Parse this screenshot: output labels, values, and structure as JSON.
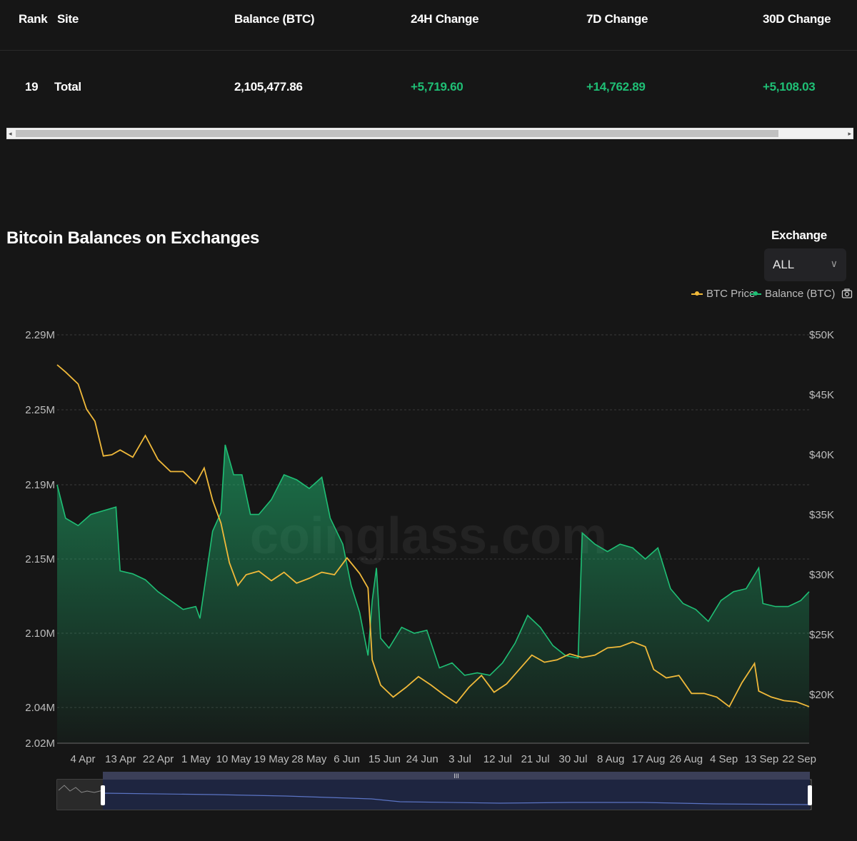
{
  "table": {
    "headers": [
      "Rank",
      "Site",
      "Balance (BTC)",
      "24H Change",
      "7D Change",
      "30D Change"
    ],
    "row": {
      "rank": "19",
      "site": "Total",
      "balance": "2,105,477.86",
      "change_24h": "+5,719.60",
      "change_7d": "+14,762.89",
      "change_30d": "+5,108.03"
    }
  },
  "scrollbar": {
    "left_arrow": "◂",
    "right_arrow": "▸"
  },
  "chart_section": {
    "title": "Bitcoin Balances on Exchanges",
    "exchange_label": "Exchange",
    "exchange_value": "ALL",
    "watermark": "coinglass.com"
  },
  "colors": {
    "btc_price": "#f0b93a",
    "balance": "#1fbf75",
    "change_positive": "#1fbf75",
    "background": "#161616"
  },
  "chart_data": {
    "type": "area",
    "legend": [
      "BTC Price",
      "Balance (BTC)"
    ],
    "legend_position": "top-right",
    "x_ticks": [
      "4 Apr",
      "13 Apr",
      "22 Apr",
      "1 May",
      "10 May",
      "19 May",
      "28 May",
      "6 Jun",
      "15 Jun",
      "24 Jun",
      "3 Jul",
      "12 Jul",
      "21 Jul",
      "30 Jul",
      "8 Aug",
      "17 Aug",
      "26 Aug",
      "4 Sep",
      "13 Sep",
      "22 Sep"
    ],
    "y_left_ticks": [
      "2.29M",
      "2.25M",
      "2.19M",
      "2.15M",
      "2.10M",
      "2.04M",
      "2.02M"
    ],
    "y_right_ticks": [
      "$50K",
      "$45K",
      "$40K",
      "$35K",
      "$30K",
      "$25K",
      "$20K"
    ],
    "y_left_range": [
      2020000,
      2290000
    ],
    "y_right_range": [
      17000,
      50000
    ],
    "grid": true,
    "series": [
      {
        "name": "Balance (BTC)",
        "axis": "left",
        "x": [
          "2022-03-30",
          "2022-04-01",
          "2022-04-04",
          "2022-04-07",
          "2022-04-10",
          "2022-04-13",
          "2022-04-14",
          "2022-04-17",
          "2022-04-20",
          "2022-04-23",
          "2022-04-26",
          "2022-04-29",
          "2022-05-02",
          "2022-05-03",
          "2022-05-06",
          "2022-05-08",
          "2022-05-09",
          "2022-05-11",
          "2022-05-13",
          "2022-05-15",
          "2022-05-17",
          "2022-05-20",
          "2022-05-23",
          "2022-05-26",
          "2022-05-29",
          "2022-06-01",
          "2022-06-03",
          "2022-06-06",
          "2022-06-08",
          "2022-06-10",
          "2022-06-12",
          "2022-06-13",
          "2022-06-14",
          "2022-06-15",
          "2022-06-17",
          "2022-06-20",
          "2022-06-23",
          "2022-06-26",
          "2022-06-29",
          "2022-07-02",
          "2022-07-05",
          "2022-07-08",
          "2022-07-11",
          "2022-07-14",
          "2022-07-17",
          "2022-07-20",
          "2022-07-23",
          "2022-07-26",
          "2022-07-29",
          "2022-08-01",
          "2022-08-02",
          "2022-08-05",
          "2022-08-08",
          "2022-08-11",
          "2022-08-14",
          "2022-08-17",
          "2022-08-20",
          "2022-08-23",
          "2022-08-26",
          "2022-08-29",
          "2022-09-01",
          "2022-09-04",
          "2022-09-07",
          "2022-09-10",
          "2022-09-13",
          "2022-09-14",
          "2022-09-17",
          "2022-09-20",
          "2022-09-23",
          "2022-09-25"
        ],
        "values": [
          2190000,
          2172000,
          2168000,
          2174000,
          2176000,
          2178000,
          2142000,
          2140000,
          2136000,
          2128000,
          2122000,
          2116000,
          2118000,
          2110000,
          2165000,
          2175000,
          2222000,
          2198000,
          2198000,
          2174000,
          2174000,
          2182000,
          2198000,
          2194000,
          2188000,
          2196000,
          2172000,
          2158000,
          2132000,
          2114000,
          2082000,
          2122000,
          2144000,
          2096000,
          2088000,
          2104000,
          2100000,
          2102000,
          2072000,
          2076000,
          2066000,
          2068000,
          2066000,
          2076000,
          2092000,
          2112000,
          2104000,
          2090000,
          2082000,
          2080000,
          2164000,
          2158000,
          2154000,
          2158000,
          2156000,
          2150000,
          2156000,
          2130000,
          2120000,
          2116000,
          2108000,
          2122000,
          2128000,
          2130000,
          2144000,
          2120000,
          2118000,
          2118000,
          2122000,
          2128000
        ]
      },
      {
        "name": "BTC Price",
        "axis": "right",
        "x": [
          "2022-03-30",
          "2022-04-01",
          "2022-04-04",
          "2022-04-06",
          "2022-04-08",
          "2022-04-10",
          "2022-04-12",
          "2022-04-14",
          "2022-04-17",
          "2022-04-20",
          "2022-04-23",
          "2022-04-26",
          "2022-04-29",
          "2022-05-02",
          "2022-05-04",
          "2022-05-06",
          "2022-05-08",
          "2022-05-10",
          "2022-05-12",
          "2022-05-14",
          "2022-05-17",
          "2022-05-20",
          "2022-05-23",
          "2022-05-26",
          "2022-05-29",
          "2022-06-01",
          "2022-06-04",
          "2022-06-07",
          "2022-06-10",
          "2022-06-12",
          "2022-06-13",
          "2022-06-15",
          "2022-06-18",
          "2022-06-21",
          "2022-06-24",
          "2022-06-27",
          "2022-06-30",
          "2022-07-03",
          "2022-07-06",
          "2022-07-09",
          "2022-07-12",
          "2022-07-15",
          "2022-07-18",
          "2022-07-21",
          "2022-07-24",
          "2022-07-27",
          "2022-07-30",
          "2022-08-02",
          "2022-08-05",
          "2022-08-08",
          "2022-08-11",
          "2022-08-14",
          "2022-08-17",
          "2022-08-19",
          "2022-08-22",
          "2022-08-25",
          "2022-08-28",
          "2022-08-31",
          "2022-09-03",
          "2022-09-06",
          "2022-09-09",
          "2022-09-12",
          "2022-09-13",
          "2022-09-16",
          "2022-09-19",
          "2022-09-22",
          "2022-09-25"
        ],
        "values": [
          47500,
          46900,
          45900,
          43800,
          42800,
          39900,
          40000,
          40400,
          39800,
          41600,
          39600,
          38600,
          38600,
          37600,
          38900,
          36200,
          34300,
          31000,
          29100,
          30000,
          30300,
          29500,
          30200,
          29300,
          29700,
          30200,
          30000,
          31400,
          30100,
          28900,
          22900,
          20800,
          19800,
          20600,
          21500,
          20800,
          20000,
          19300,
          20600,
          21600,
          20200,
          20900,
          22100,
          23300,
          22700,
          22900,
          23400,
          23100,
          23300,
          23900,
          24000,
          24400,
          24000,
          22100,
          21400,
          21600,
          20100,
          20100,
          19800,
          19000,
          21000,
          22600,
          20300,
          19800,
          19500,
          19400,
          19000
        ]
      }
    ]
  }
}
